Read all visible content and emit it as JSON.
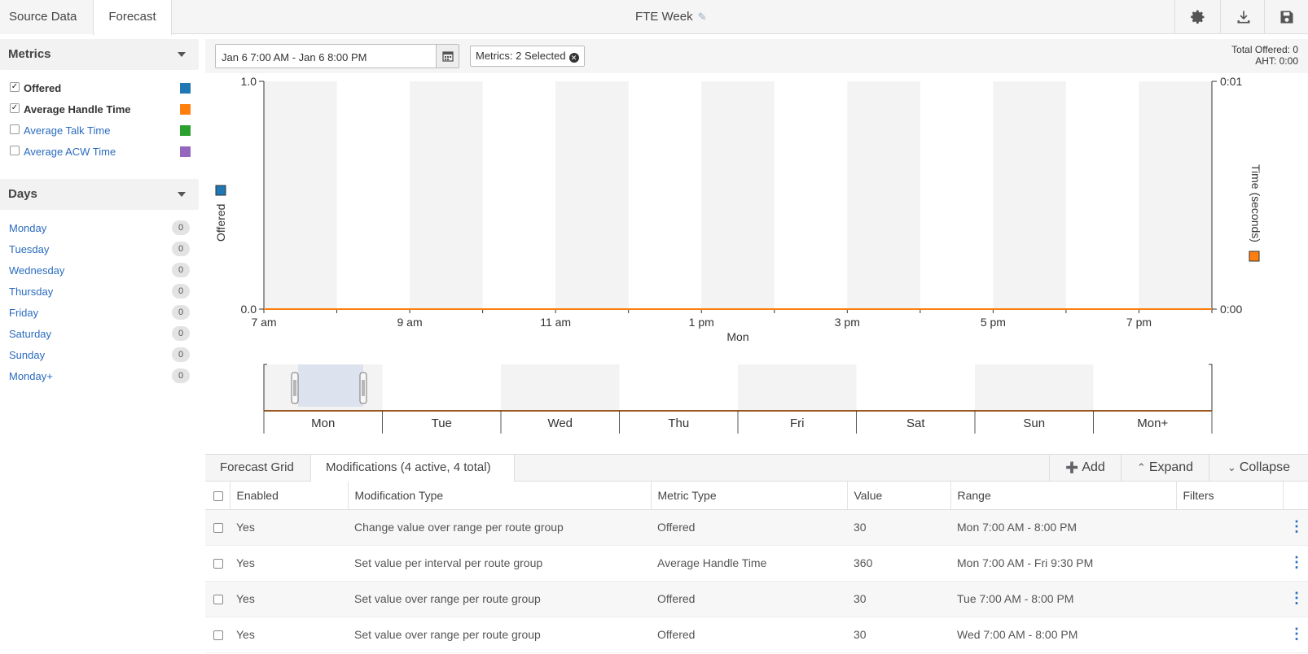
{
  "topbar": {
    "tabs": [
      "Source Data",
      "Forecast"
    ],
    "title": "FTE Week",
    "icons": [
      "gear-icon",
      "download-icon",
      "save-icon"
    ]
  },
  "metrics_panel": {
    "title": "Metrics",
    "items": [
      {
        "label": "Offered",
        "checked": true,
        "color": "#1f77b4"
      },
      {
        "label": "Average Handle Time",
        "checked": true,
        "color": "#ff7f0e"
      },
      {
        "label": "Average Talk Time",
        "checked": false,
        "color": "#2ca02c"
      },
      {
        "label": "Average ACW Time",
        "checked": false,
        "color": "#9467bd"
      }
    ]
  },
  "days_panel": {
    "title": "Days",
    "items": [
      {
        "label": "Monday",
        "count": "0"
      },
      {
        "label": "Tuesday",
        "count": "0"
      },
      {
        "label": "Wednesday",
        "count": "0"
      },
      {
        "label": "Thursday",
        "count": "0"
      },
      {
        "label": "Friday",
        "count": "0"
      },
      {
        "label": "Saturday",
        "count": "0"
      },
      {
        "label": "Sunday",
        "count": "0"
      },
      {
        "label": "Monday+",
        "count": "0"
      }
    ]
  },
  "toolbar": {
    "date_range": "Jan 6 7:00 AM - Jan 6 8:00 PM",
    "metrics_chip": "Metrics: 2 Selected",
    "total_offered": "Total Offered: 0",
    "aht": "AHT: 0:00"
  },
  "chart_data": [
    {
      "type": "line",
      "x_ticks": [
        "7 am",
        "9 am",
        "11 am",
        "1 pm",
        "3 pm",
        "5 pm",
        "7 pm"
      ],
      "xlabel": "Mon",
      "ylabel": "Offered",
      "y2label": "Time (seconds)",
      "y_ticks": [
        "1.0",
        "0.0"
      ],
      "y2_ticks": [
        "0:01",
        "0:00"
      ],
      "ylim": [
        0,
        1
      ],
      "series": [
        {
          "name": "Offered",
          "color": "#1f77b4",
          "values": [
            0,
            0,
            0,
            0,
            0,
            0,
            0,
            0,
            0,
            0,
            0,
            0,
            0,
            0
          ]
        },
        {
          "name": "Average Handle Time",
          "color": "#ff7f0e",
          "values": [
            0,
            0,
            0,
            0,
            0,
            0,
            0,
            0,
            0,
            0,
            0,
            0,
            0,
            0
          ]
        }
      ]
    },
    {
      "type": "line",
      "categories": [
        "Mon",
        "Tue",
        "Wed",
        "Thu",
        "Fri",
        "Sat",
        "Sun",
        "Mon+"
      ],
      "series": [
        {
          "name": "Average Handle Time",
          "color": "#ff7f0e",
          "values": [
            0,
            0,
            0,
            0,
            0,
            0,
            0,
            0
          ]
        }
      ]
    }
  ],
  "grid": {
    "tabs": [
      "Forecast Grid",
      "Modifications (4 active, 4 total)"
    ],
    "buttons": [
      "Add",
      "Expand",
      "Collapse"
    ],
    "columns": [
      "Enabled",
      "Modification Type",
      "Metric Type",
      "Value",
      "Range",
      "Filters"
    ],
    "rows": [
      {
        "enabled": "Yes",
        "type": "Change value over range per route group",
        "metric": "Offered",
        "value": "30",
        "range": "Mon 7:00 AM - 8:00 PM",
        "filters": ""
      },
      {
        "enabled": "Yes",
        "type": "Set value per interval per route group",
        "metric": "Average Handle Time",
        "value": "360",
        "range": "Mon 7:00 AM - Fri 9:30 PM",
        "filters": ""
      },
      {
        "enabled": "Yes",
        "type": "Set value over range per route group",
        "metric": "Offered",
        "value": "30",
        "range": "Tue 7:00 AM - 8:00 PM",
        "filters": ""
      },
      {
        "enabled": "Yes",
        "type": "Set value over range per route group",
        "metric": "Offered",
        "value": "30",
        "range": "Wed 7:00 AM - 8:00 PM",
        "filters": ""
      }
    ]
  }
}
